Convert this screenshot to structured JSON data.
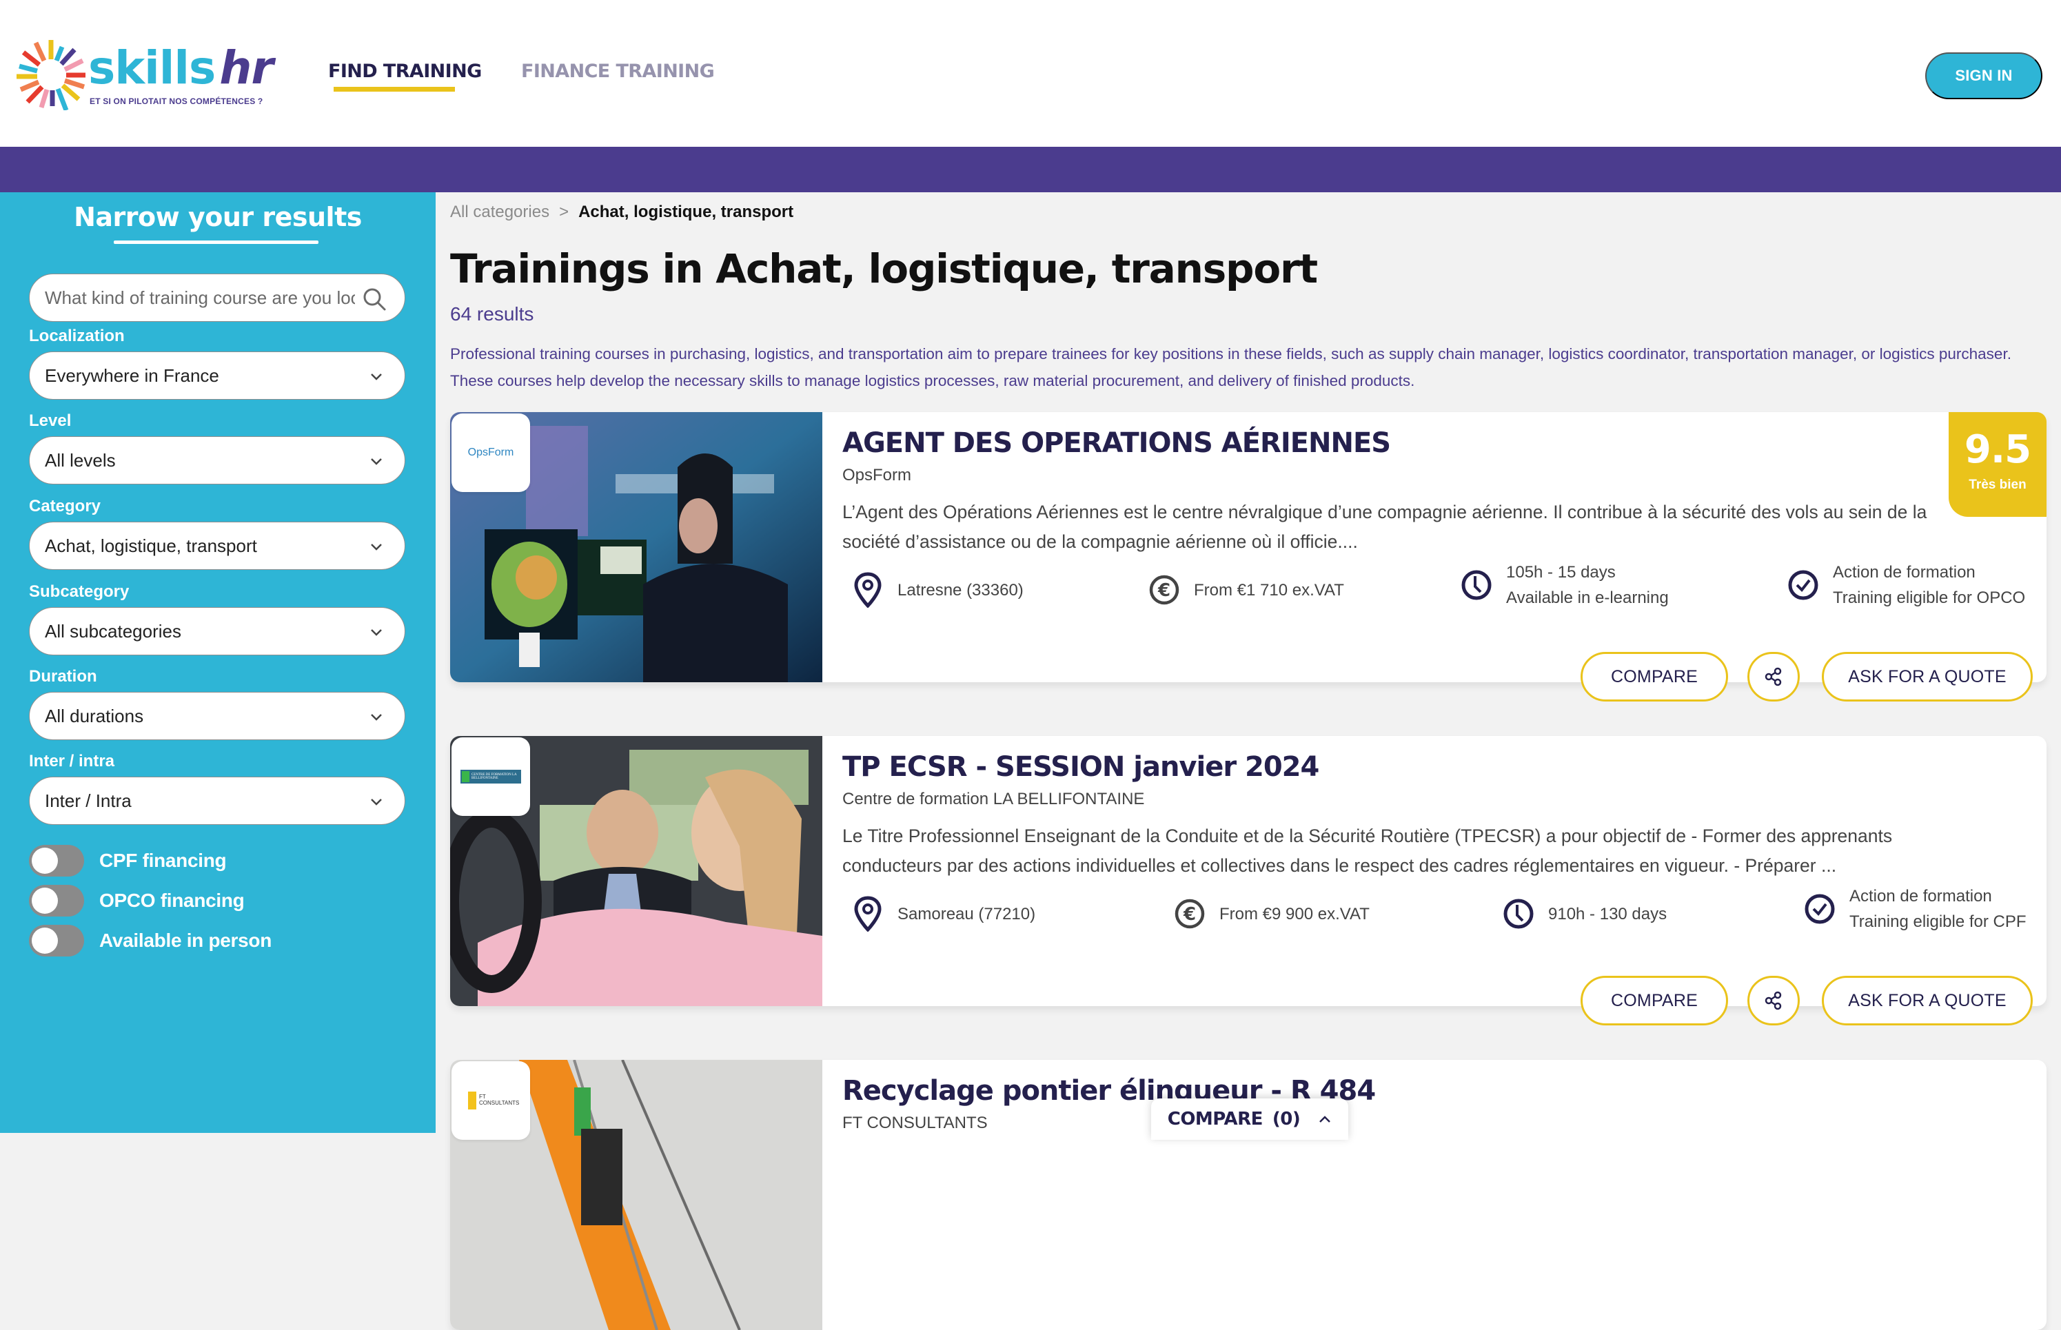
{
  "header": {
    "logo": {
      "brand_main": "skills",
      "brand_accent": "hr",
      "tagline": "ET SI ON PILOTAIT NOS COMPÉTENCES ?"
    },
    "nav": [
      {
        "label": "FIND TRAINING",
        "active": true
      },
      {
        "label": "FINANCE TRAINING",
        "active": false
      }
    ],
    "sign_in_label": "SIGN IN"
  },
  "colors": {
    "primary_cyan": "#2eb5d6",
    "brand_purple": "#4b3c8e",
    "accent_yellow": "#eac31b",
    "navy_text": "#24204d",
    "toggle_off": "#8a8a8a"
  },
  "sidebar": {
    "title": "Narrow your results",
    "search": {
      "placeholder": "What kind of training course are you looking for?",
      "value": "",
      "icon": "search-icon"
    },
    "filters": [
      {
        "label": "Localization",
        "value": "Everywhere in France"
      },
      {
        "label": "Level",
        "value": "All levels"
      },
      {
        "label": "Category",
        "value": "Achat, logistique, transport"
      },
      {
        "label": "Subcategory",
        "value": "All subcategories"
      },
      {
        "label": "Duration",
        "value": "All durations"
      },
      {
        "label": "Inter / intra",
        "value": "Inter / Intra"
      }
    ],
    "toggles": [
      {
        "label": "CPF financing",
        "on": false
      },
      {
        "label": "OPCO financing",
        "on": false
      },
      {
        "label": "Available in person",
        "on": false
      }
    ]
  },
  "main": {
    "breadcrumb": {
      "root": "All categories",
      "separator": ">",
      "current": "Achat, logistique, transport"
    },
    "title": "Trainings in Achat, logistique, transport",
    "result_count": "64 results",
    "description": "Professional training courses in purchasing, logistics, and transportation aim to prepare trainees for key positions in these fields, such as supply chain manager, logistics coordinator, transportation manager, or logistics purchaser. These courses help develop the necessary skills to manage logistics processes, raw material procurement, and delivery of finished products.",
    "cards": [
      {
        "title": "AGENT DES OPERATIONS AÉRIENNES",
        "provider": "OpsForm",
        "provider_logo_text": "OpsForm",
        "description": "L’Agent des Opérations Aériennes est le centre névralgique d’une compagnie aérienne. Il contribue à la sécurité des vols au sein de la société d’assistance ou de la compagnie aérienne où il officie....",
        "location": "Latresne (33360)",
        "price": "From €1 710 ex.VAT",
        "duration_line1": "105h - 15 days",
        "duration_line2": "Available in e-learning",
        "eligibility_line1": "Action de formation",
        "eligibility_line2": "Training eligible for OPCO",
        "score": "9.5",
        "score_label": "Très bien",
        "compare_label": "COMPARE",
        "quote_label": "ASK FOR A QUOTE"
      },
      {
        "title": "TP ECSR - SESSION janvier 2024",
        "provider": "Centre de formation LA BELLIFONTAINE",
        "provider_logo_text": "CENTRE DE FORMATION LA BELLIFONTAINE",
        "description": "Le Titre Professionnel Enseignant de la Conduite et de la Sécurité Routière (TPECSR) a pour objectif de - Former des apprenants conducteurs par des actions individuelles et collectives dans le respect des cadres réglementaires en vigueur. - Préparer ...",
        "location": "Samoreau (77210)",
        "price": "From €9 900 ex.VAT",
        "duration_line1": "910h - 130 days",
        "duration_line2": "",
        "eligibility_line1": "Action de formation",
        "eligibility_line2": "Training eligible for CPF",
        "compare_label": "COMPARE",
        "quote_label": "ASK FOR A QUOTE"
      },
      {
        "title": "Recyclage pontier élingueur - R 484",
        "provider": "FT CONSULTANTS",
        "provider_logo_text": "FT CONSULTANTS"
      }
    ],
    "compare_bar": {
      "label": "COMPARE",
      "count": "(0)"
    }
  }
}
